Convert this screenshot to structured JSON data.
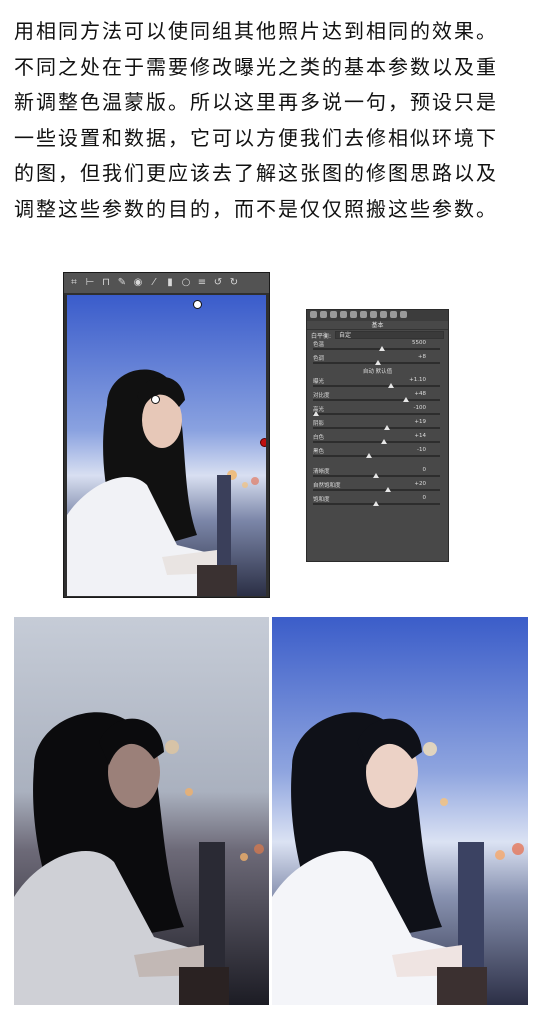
{
  "paragraph": {
    "lines": [
      "用相同方法可以使同组其他照片达到相同的效果。",
      "不同之处在于需要修改曝光之类的基本参数以及重",
      "新调整色温蒙版。所以这里再多说一句，预设只是",
      "一些设置和数据，它可以方便我们去修相似环境下",
      "的图，但我们更应该去了解这张图的修图思路以及",
      "调整这些参数的目的，而不是仅仅照搬这些参数。"
    ]
  },
  "toolbar": {
    "icons": [
      "crop-icon",
      "straighten-icon",
      "spot-icon",
      "brush-icon",
      "redeye-icon",
      "adjust-brush-icon",
      "gradient-icon",
      "radial-icon",
      "list-icon",
      "rotate-left-icon",
      "rotate-right-icon"
    ]
  },
  "panel": {
    "title": "基本",
    "wb_label": "白平衡:",
    "wb_value": "自定",
    "sliders_top": [
      {
        "label": "色温",
        "value": "5500",
        "pos": 0.55
      },
      {
        "label": "色调",
        "value": "+8",
        "pos": 0.52
      }
    ],
    "section": "自动   默认值",
    "sliders_mid": [
      {
        "label": "曝光",
        "value": "+1.10",
        "pos": 0.62
      },
      {
        "label": "对比度",
        "value": "+48",
        "pos": 0.74
      },
      {
        "label": "高光",
        "value": "-100",
        "pos": 0.02
      },
      {
        "label": "阴影",
        "value": "+19",
        "pos": 0.59
      },
      {
        "label": "白色",
        "value": "+14",
        "pos": 0.57
      },
      {
        "label": "黑色",
        "value": "-10",
        "pos": 0.45
      }
    ],
    "sliders_bottom": [
      {
        "label": "清晰度",
        "value": "0",
        "pos": 0.5
      },
      {
        "label": "自然饱和度",
        "value": "+20",
        "pos": 0.6
      },
      {
        "label": "饱和度",
        "value": "0",
        "pos": 0.5
      }
    ]
  },
  "colors": {
    "sky_top": "#3b5dc9",
    "sky_bottom": "#cfd8ee",
    "dark_photo_sky": "#b9c2d2",
    "hair": "#111111",
    "shirt": "#f1f1f5"
  }
}
